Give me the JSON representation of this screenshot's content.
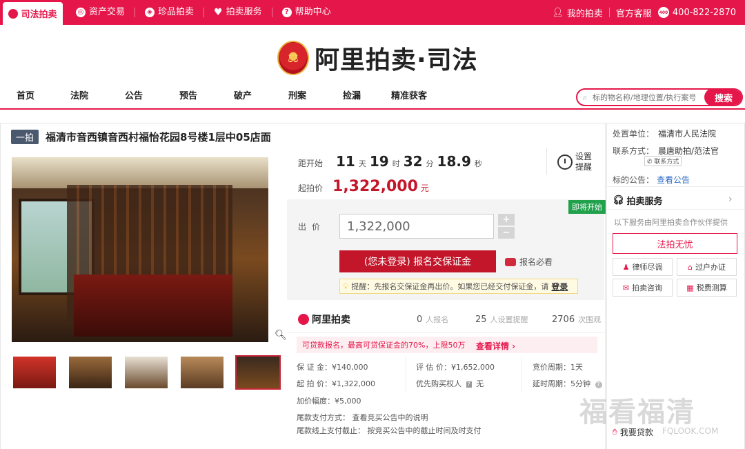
{
  "topbar": {
    "home_label": "司法拍卖",
    "nav": [
      {
        "label": "资产交易",
        "icon": "asset-icon"
      },
      {
        "label": "珍品拍卖",
        "icon": "treasure-icon"
      },
      {
        "label": "拍卖服务",
        "icon": "heart-icon"
      },
      {
        "label": "帮助中心",
        "icon": "help-icon"
      }
    ],
    "my_auction": "我的拍卖",
    "official_service": "官方客服",
    "phone": "400-822-2870",
    "phone_badge": "400"
  },
  "logo": {
    "text": "阿里拍卖·司法"
  },
  "mainnav": {
    "links": [
      "首页",
      "法院",
      "公告",
      "预告",
      "破产",
      "刑案",
      "捡漏",
      "精准获客"
    ],
    "search_placeholder": "标的物名称/地理位置/执行案号",
    "search_button": "搜索"
  },
  "item": {
    "tag": "一拍",
    "title": "福清市音西镇音西村福怡花园8号楼1层中05店面"
  },
  "countdown": {
    "label": "距开始",
    "days": "11",
    "days_unit": "天",
    "hours": "19",
    "hours_unit": "时",
    "minutes": "32",
    "minutes_unit": "分",
    "seconds": "18.9",
    "seconds_unit": "秒",
    "remind_label": "设置提醒"
  },
  "start_price": {
    "label": "起拍价",
    "value": "1,322,000",
    "unit": "元"
  },
  "bid": {
    "badge": "即将开始",
    "label": "出价",
    "value": "1,322,000",
    "plus": "+",
    "minus": "−",
    "signup_button": "(您未登录) 报名交保证金",
    "must_read": "报名必看",
    "tip_text": "提醒：先报名交保证金再出价。如果您已经交付保证金，请",
    "tip_login": "登录"
  },
  "stats": {
    "brand": "阿里拍卖",
    "signups": "0",
    "signups_unit": "人报名",
    "reminders": "25",
    "reminders_unit": "人设置提醒",
    "views": "2706",
    "views_unit": "次围观"
  },
  "banner": {
    "text": "可贷款报名，最高可贷保证金的70%，上限50万",
    "more": "查看详情 ›"
  },
  "details": {
    "deposit": "保 证 金：¥140,000",
    "start": "起 拍 价：¥1,322,000",
    "increment": "加价幅度：¥5,000",
    "appraisal": "评 估 价：¥1,652,000",
    "priority": "优先购买权人",
    "priority_value": "无",
    "cycle": "竞价周期：1天",
    "delay": "延时周期：5分钟",
    "payment": "尾款支付方式：  查看竞买公告中的说明",
    "deadline": "尾款线上支付截止：  按竞买公告中的截止时间及时支付"
  },
  "side": {
    "unit_label": "处置单位：",
    "unit_value": "福清市人民法院",
    "contact_label": "联系方式：",
    "contact_value": "晨唐助拍/范法官",
    "contact_tag": "联系方式",
    "notice_label": "标的公告：",
    "notice_link": "查看公告",
    "service_title": "拍卖服务",
    "service_note": "以下服务由阿里拍卖合作伙伴提供",
    "legal_button": "法拍无忧",
    "services": [
      "律师尽调",
      "过户办证",
      "拍卖咨询",
      "税费测算"
    ],
    "footer": "我要贷款"
  },
  "watermark": {
    "big": "福看福清",
    "small": "FQLOOK.COM"
  }
}
